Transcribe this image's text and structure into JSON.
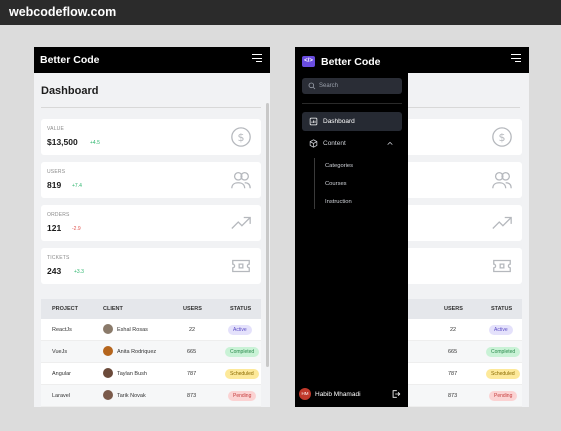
{
  "page": {
    "brand": "webcodeflow.com"
  },
  "app": {
    "title": "Better Code"
  },
  "dashboard": {
    "title": "Dashboard",
    "cards": [
      {
        "label": "VALUE",
        "value": "$13,500",
        "change": "+4.5",
        "trend": "up",
        "icon": "dollar-icon"
      },
      {
        "label": "USERS",
        "value": "819",
        "change": "+7.4",
        "trend": "up",
        "icon": "users-icon"
      },
      {
        "label": "ORDERS",
        "value": "121",
        "change": "-2.9",
        "trend": "down",
        "icon": "trending-up-icon"
      },
      {
        "label": "TICKETS",
        "value": "243",
        "change": "+3.3",
        "trend": "up",
        "icon": "ticket-icon"
      }
    ]
  },
  "table": {
    "headers": {
      "project": "PROJECT",
      "client": "CLIENT",
      "users": "USERS",
      "status": "STATUS"
    },
    "rows": [
      {
        "project": "ReactJs",
        "client": "Eshal Rosas",
        "users": "22",
        "status": "Active"
      },
      {
        "project": "VueJs",
        "client": "Anita Rodriquez",
        "users": "665",
        "status": "Completed"
      },
      {
        "project": "Angular",
        "client": "Taylan Bush",
        "users": "787",
        "status": "Scheduled"
      },
      {
        "project": "Laravel",
        "client": "Tarik Novak",
        "users": "873",
        "status": "Pending"
      }
    ]
  },
  "sidebar": {
    "title": "Better Code",
    "search_placeholder": "Search",
    "items": [
      {
        "label": "Dashboard",
        "icon": "dashboard-icon"
      },
      {
        "label": "Content",
        "icon": "cube-icon"
      }
    ],
    "sub_items": [
      "Categories",
      "Courses",
      "Instruction"
    ],
    "user": {
      "name": "Habib Mhamadi",
      "initials": "HM"
    }
  },
  "colors": {
    "active_bg": "#e4e1fb",
    "active_fg": "#5b4cc4",
    "completed_bg": "#c9f2d6",
    "completed_fg": "#2a8a4c",
    "scheduled_bg": "#fde99a",
    "scheduled_fg": "#8a6a00",
    "pending_bg": "#fbd3d3",
    "pending_fg": "#c53d3d"
  }
}
